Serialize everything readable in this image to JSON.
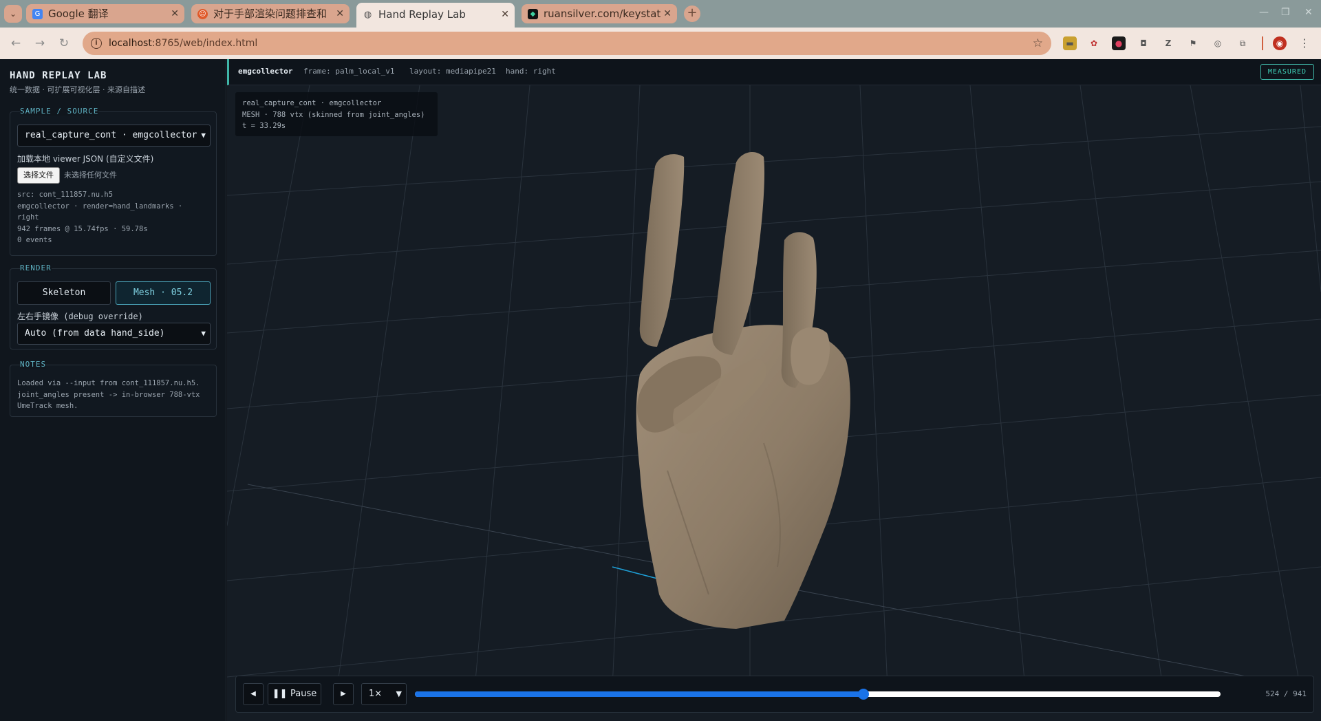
{
  "browser": {
    "tabs": [
      {
        "label": "Google 翻译",
        "icon": "google-translate-icon"
      },
      {
        "label": "对于手部渲染问题排查和",
        "icon": "emoji-face-icon"
      },
      {
        "label": "Hand Replay Lab",
        "icon": "globe-icon",
        "active": true
      },
      {
        "label": "ruansilver.com/keystatic",
        "icon": "diamond-icon"
      }
    ],
    "url_host": "localhost",
    "url_rest": ":8765/web/index.html"
  },
  "sidebar": {
    "brand": "HAND REPLAY LAB",
    "subtitle": "统一数据 · 可扩展可视化层 · 来源自描述",
    "sample": {
      "title": "SAMPLE / SOURCE",
      "selected": "real_capture_cont · emgcollector",
      "load_label": "加载本地 viewer JSON (自定义文件)",
      "file_button": "选择文件",
      "file_none": "未选择任何文件",
      "meta": [
        "src: cont_111857.nu.h5",
        "emgcollector · render=hand_landmarks ·",
        "right",
        "942 frames @ 15.74fps · 59.78s",
        "0 events"
      ]
    },
    "render": {
      "title": "RENDER",
      "skeleton_label": "Skeleton",
      "mesh_label": "Mesh · 05.2",
      "mirror_label": "左右手镜像 (debug override)",
      "mirror_selected": "Auto (from data hand_side)"
    },
    "notes": {
      "title": "NOTES",
      "text": "Loaded via --input from cont_111857.nu.h5. joint_angles present -> in-browser 788-vtx UmeTrack mesh."
    }
  },
  "stage": {
    "source": "emgcollector",
    "frame": "frame: palm_local_v1",
    "layout": "layout: mediapipe21",
    "hand": "hand: right",
    "badge": "MEASURED",
    "overlay": [
      "real_capture_cont · emgcollector",
      "MESH · 788 vtx (skinned from joint_angles)",
      "t = 33.29s"
    ]
  },
  "controls": {
    "prev_icon": "◀",
    "pause_label": "Pause",
    "next_icon": "▶",
    "speed": "1×",
    "frame_current": 524,
    "frame_total": 941,
    "frame_label": "524 / 941"
  },
  "colors": {
    "accent": "#3fb6a8",
    "mesh": "#8a7a66",
    "progress": "#1a73e8"
  }
}
